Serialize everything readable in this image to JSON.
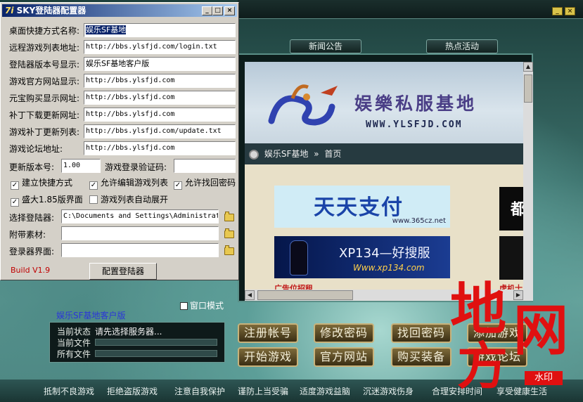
{
  "dialog": {
    "title": "SKY登陆器配置器",
    "title_logo": "7i",
    "minimize": "_",
    "maximize": "□",
    "close": "×",
    "fields": [
      {
        "label": "桌面快捷方式名称:",
        "value": "娱乐SF基地"
      },
      {
        "label": "远程游戏列表地址:",
        "value": "http://bbs.ylsfjd.com/login.txt"
      },
      {
        "label": "登陆器版本号显示:",
        "value": "娱乐SF基地客户版"
      },
      {
        "label": "游戏官方网站显示:",
        "value": "http://bbs.ylsfjd.com"
      },
      {
        "label": "元宝购买显示网址:",
        "value": "http://bbs.ylsfjd.com"
      },
      {
        "label": "补丁下载更新网址:",
        "value": "http://bbs.ylsfjd.com"
      },
      {
        "label": "游戏补丁更新列表:",
        "value": "http://bbs.ylsfjd.com/update.txt"
      },
      {
        "label": "游戏论坛地址:",
        "value": "http://bbs.ylsfjd.com"
      }
    ],
    "update_version_label": "更新版本号:",
    "update_version_value": "1.00",
    "verify_code_label": "游戏登录验证码:",
    "verify_code_value": "",
    "checkboxes": [
      {
        "label": "建立快捷方式",
        "checked": true
      },
      {
        "label": "允许编辑游戏列表",
        "checked": true
      },
      {
        "label": "允许找回密码",
        "checked": true
      },
      {
        "label": "盛大1.85版界面",
        "checked": true
      },
      {
        "label": "游戏列表自动展开",
        "checked": false
      }
    ],
    "select_launcher_label": "选择登陆器:",
    "select_launcher_value": "C:\\Documents and Settings\\Administrat",
    "attach_label": "附带素材:",
    "attach_value": "",
    "ui_label": "登录器界面:",
    "ui_value": "",
    "build": "Build V1.9",
    "configure_button": "配置登陆器",
    "check_mark": "✓"
  },
  "launcher": {
    "tab_news": "新闻公告",
    "tab_events": "热点活动",
    "min_btn": "_",
    "close_btn": "×",
    "banner_title": "娱樂私服基地",
    "banner_url": "WWW.YLSFJD.COM",
    "breadcrumb_site": "娱乐SF基地",
    "breadcrumb_sep": "»",
    "breadcrumb_home": "首页",
    "ad1_text": "天天支付",
    "ad1_url": "www.365cz.net",
    "ad2_text": "XP134—好搜服",
    "ad2_url": "Www.xp134.com",
    "ad_caption": "广告位招租",
    "ad_caption2": "虎机士",
    "side_char": "都",
    "window_mode": "窗口模式",
    "client_name": "娱乐SF基地客户版",
    "status_label": "当前状态",
    "status_value": "请先选择服务器...",
    "current_file_label": "当前文件",
    "all_files_label": "所有文件",
    "buttons": [
      "注册帐号",
      "修改密码",
      "找回密码",
      "添加游戏",
      "开始游戏",
      "官方网站",
      "购买装备",
      "游戏论坛"
    ],
    "footer": [
      "抵制不良游戏",
      "拒绝盗版游戏",
      "注意自我保护",
      "谨防上当受骗",
      "适度游戏益脑",
      "沉迷游戏伤身",
      "合理安排时间",
      "享受健康生活"
    ],
    "stamp_chars": [
      "地",
      "网",
      "方"
    ],
    "stamp_badge": "水印"
  }
}
